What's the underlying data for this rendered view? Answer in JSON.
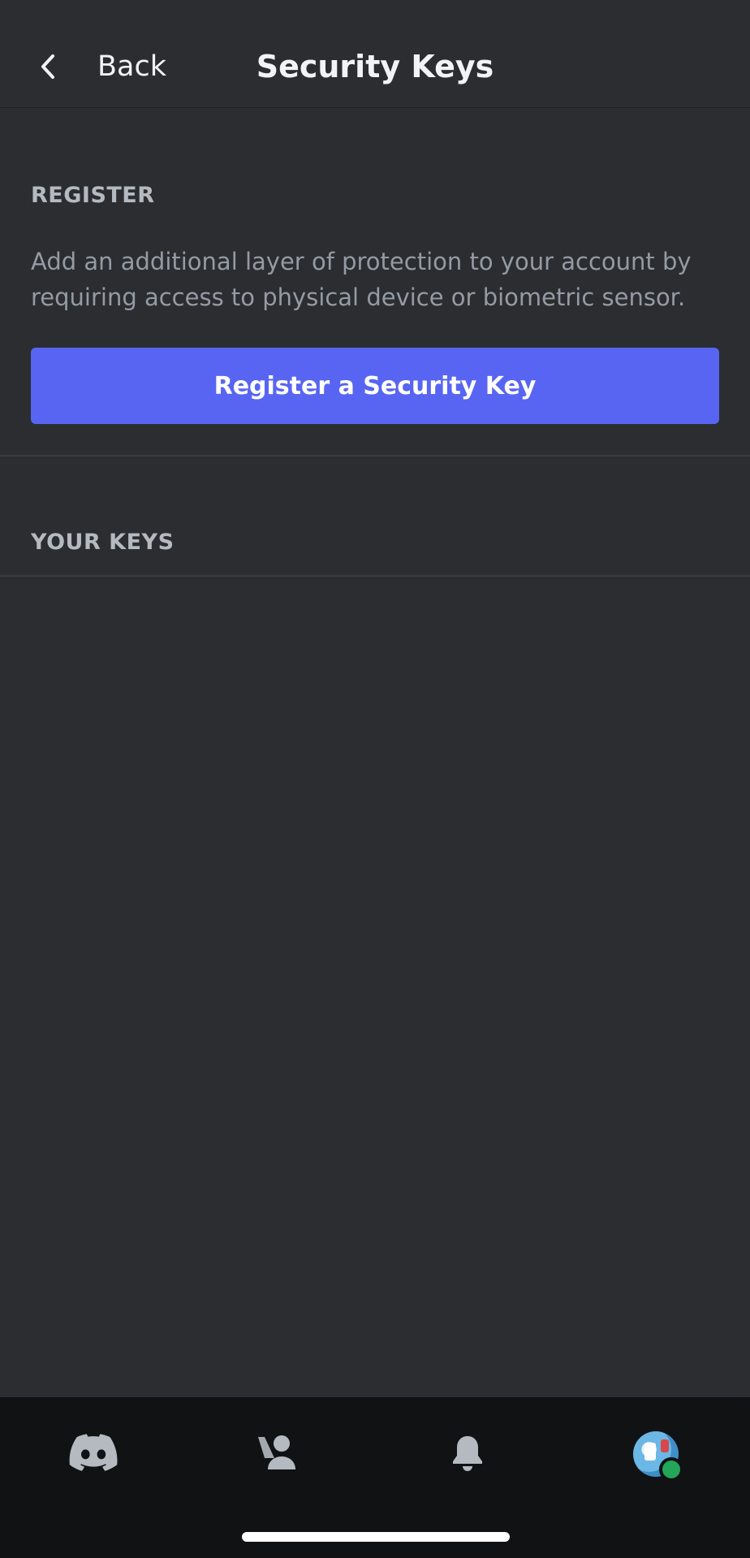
{
  "header": {
    "back_label": "Back",
    "title": "Security Keys"
  },
  "register_section": {
    "label": "REGISTER",
    "description": "Add an additional layer of protection to your account by requiring access to physical device or biometric sensor.",
    "button_label": "Register a Security Key"
  },
  "keys_section": {
    "label": "YOUR KEYS",
    "keys": []
  },
  "bottom_nav": {
    "items": [
      {
        "name": "home",
        "icon": "discord-logo-icon"
      },
      {
        "name": "friends",
        "icon": "friends-icon"
      },
      {
        "name": "notifications",
        "icon": "bell-icon"
      },
      {
        "name": "profile",
        "icon": "avatar",
        "status": "online"
      }
    ]
  },
  "colors": {
    "background": "#2b2d31",
    "accent": "#5865f2",
    "nav_background": "#111214",
    "online": "#23a55a"
  }
}
